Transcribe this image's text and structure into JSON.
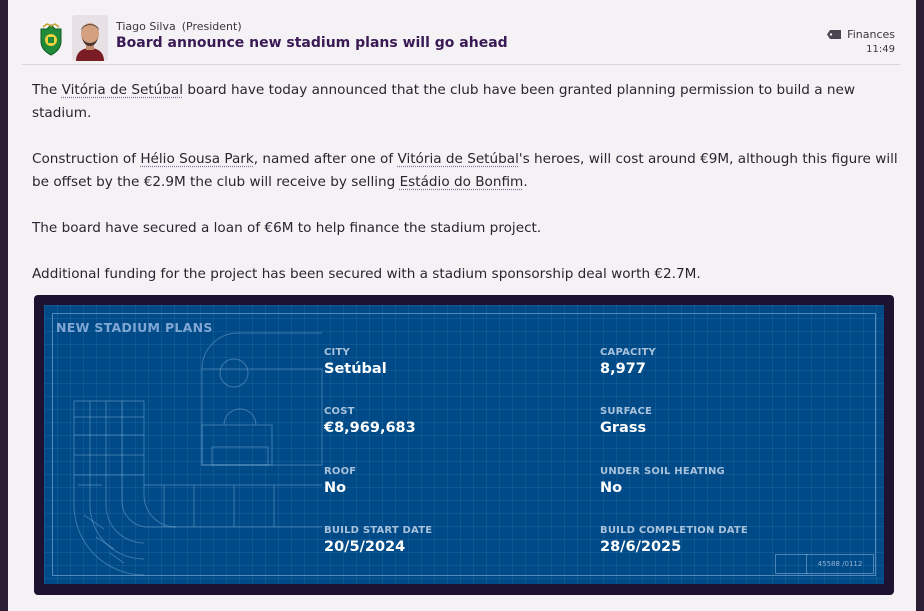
{
  "message": {
    "sender_name": "Tiago Silva",
    "sender_role": "(President)",
    "title": "Board announce new stadium plans will go ahead",
    "category": "Finances",
    "time": "11:49"
  },
  "body": {
    "p1_a": "The ",
    "p1_link_club": "Vitória de Setúbal",
    "p1_b": " board have today announced that the club have been granted planning permission to build a new stadium.",
    "p2_a": "Construction of ",
    "p2_link_stadium": "Hélio Sousa Park",
    "p2_b": ", named after one of ",
    "p2_link_club": "Vitória de Setúbal",
    "p2_c": "'s heroes, will cost around €9M, although this figure will be offset by the €2.9M the club will receive by selling ",
    "p2_link_old": "Estádio do Bonfim",
    "p2_d": ".",
    "p3": "The board have secured a loan of €6M to help finance the stadium project.",
    "p4": "Additional funding for the project has been secured with a stadium sponsorship deal worth €2.7M."
  },
  "plans": {
    "title": "NEW STADIUM PLANS",
    "city_label": "CITY",
    "city": "Setúbal",
    "capacity_label": "CAPACITY",
    "capacity": "8,977",
    "cost_label": "COST",
    "cost": "€8,969,683",
    "surface_label": "SURFACE",
    "surface": "Grass",
    "roof_label": "ROOF",
    "roof": "No",
    "heating_label": "UNDER SOIL HEATING",
    "heating": "No",
    "start_label": "BUILD START DATE",
    "start": "20/5/2024",
    "completion_label": "BUILD COMPLETION DATE",
    "completion": "28/6/2025",
    "ref": "45588 /0112"
  },
  "icons": {
    "club_crest": "club-crest-icon",
    "category_tag": "tag-icon"
  },
  "colors": {
    "title": "#3a1a55",
    "blueprint": "#004b87",
    "card_border": "#1d1230"
  }
}
